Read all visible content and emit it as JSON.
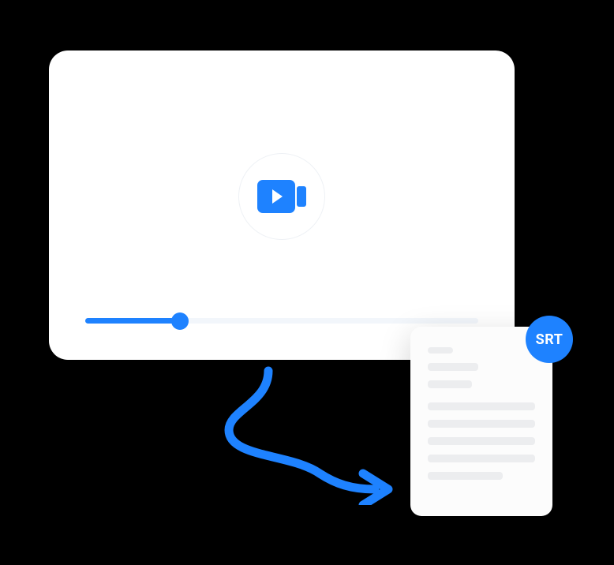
{
  "video": {
    "progress_percent": 24
  },
  "document": {
    "badge_label": "SRT"
  },
  "colors": {
    "accent": "#1e82ff"
  }
}
